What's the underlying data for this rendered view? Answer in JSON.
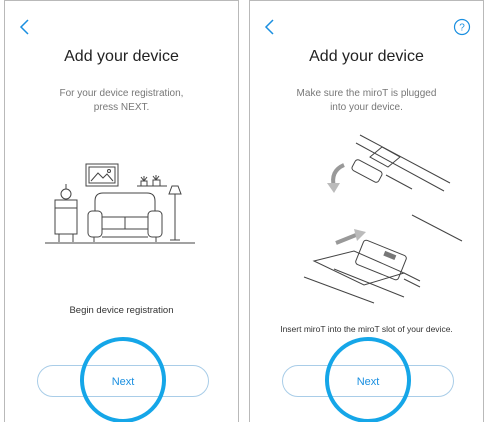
{
  "screen1": {
    "title": "Add your device",
    "subtitle": "For your device registration,\npress NEXT.",
    "caption": "Begin device registration",
    "next_label": "Next",
    "illustration": "living-room-illustration"
  },
  "screen2": {
    "title": "Add your device",
    "subtitle": "Make sure the miroT is plugged\ninto your device.",
    "caption": "Insert miroT into the miroT slot of your device.",
    "next_label": "Next",
    "illustration": "insert-mirot-illustration"
  },
  "colors": {
    "accent": "#1a8fe0",
    "highlight_ring": "#15a6e8",
    "button_border": "#a9cde8",
    "text_muted": "#777777"
  },
  "icons": {
    "back": "chevron-left-icon",
    "help": "help-circle-icon"
  }
}
